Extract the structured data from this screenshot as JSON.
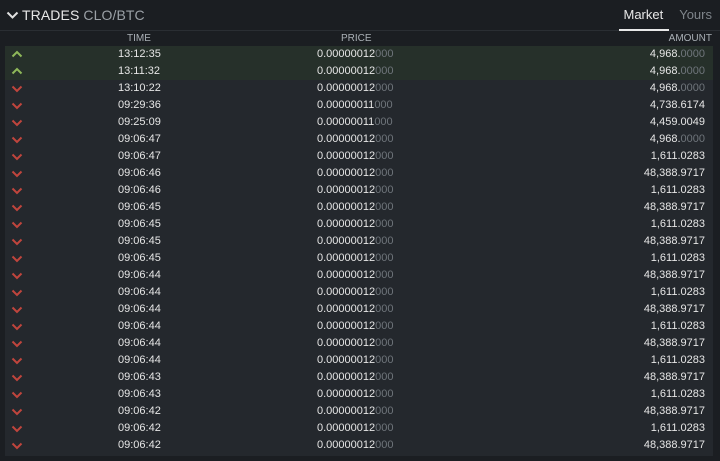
{
  "header": {
    "title": "TRADES",
    "pair": "CLO/BTC",
    "tabs": [
      {
        "label": "Market",
        "active": true
      },
      {
        "label": "Yours",
        "active": false
      }
    ]
  },
  "columns": {
    "time": "TIME",
    "price": "PRICE",
    "amount": "AMOUNT"
  },
  "colors": {
    "up": "#8fb85a",
    "down": "#c0453d",
    "dim": "#6f757b",
    "highlight": "#26302a"
  },
  "trades": [
    {
      "dir": "up",
      "time": "13:12:35",
      "price_main": "0.00000012",
      "price_dim": "000",
      "amount_main": "4,968.",
      "amount_dim": "0000"
    },
    {
      "dir": "up",
      "time": "13:11:32",
      "price_main": "0.00000012",
      "price_dim": "000",
      "amount_main": "4,968.",
      "amount_dim": "0000"
    },
    {
      "dir": "down",
      "time": "13:10:22",
      "price_main": "0.00000012",
      "price_dim": "000",
      "amount_main": "4,968.",
      "amount_dim": "0000"
    },
    {
      "dir": "down",
      "time": "09:29:36",
      "price_main": "0.00000011",
      "price_dim": "000",
      "amount_main": "4,738.6174",
      "amount_dim": ""
    },
    {
      "dir": "down",
      "time": "09:25:09",
      "price_main": "0.00000011",
      "price_dim": "000",
      "amount_main": "4,459.0049",
      "amount_dim": ""
    },
    {
      "dir": "down",
      "time": "09:06:47",
      "price_main": "0.00000012",
      "price_dim": "000",
      "amount_main": "4,968.",
      "amount_dim": "0000"
    },
    {
      "dir": "down",
      "time": "09:06:47",
      "price_main": "0.00000012",
      "price_dim": "000",
      "amount_main": "1,611.0283",
      "amount_dim": ""
    },
    {
      "dir": "down",
      "time": "09:06:46",
      "price_main": "0.00000012",
      "price_dim": "000",
      "amount_main": "48,388.9717",
      "amount_dim": ""
    },
    {
      "dir": "down",
      "time": "09:06:46",
      "price_main": "0.00000012",
      "price_dim": "000",
      "amount_main": "1,611.0283",
      "amount_dim": ""
    },
    {
      "dir": "down",
      "time": "09:06:45",
      "price_main": "0.00000012",
      "price_dim": "000",
      "amount_main": "48,388.9717",
      "amount_dim": ""
    },
    {
      "dir": "down",
      "time": "09:06:45",
      "price_main": "0.00000012",
      "price_dim": "000",
      "amount_main": "1,611.0283",
      "amount_dim": ""
    },
    {
      "dir": "down",
      "time": "09:06:45",
      "price_main": "0.00000012",
      "price_dim": "000",
      "amount_main": "48,388.9717",
      "amount_dim": ""
    },
    {
      "dir": "down",
      "time": "09:06:45",
      "price_main": "0.00000012",
      "price_dim": "000",
      "amount_main": "1,611.0283",
      "amount_dim": ""
    },
    {
      "dir": "down",
      "time": "09:06:44",
      "price_main": "0.00000012",
      "price_dim": "000",
      "amount_main": "48,388.9717",
      "amount_dim": ""
    },
    {
      "dir": "down",
      "time": "09:06:44",
      "price_main": "0.00000012",
      "price_dim": "000",
      "amount_main": "1,611.0283",
      "amount_dim": ""
    },
    {
      "dir": "down",
      "time": "09:06:44",
      "price_main": "0.00000012",
      "price_dim": "000",
      "amount_main": "48,388.9717",
      "amount_dim": ""
    },
    {
      "dir": "down",
      "time": "09:06:44",
      "price_main": "0.00000012",
      "price_dim": "000",
      "amount_main": "1,611.0283",
      "amount_dim": ""
    },
    {
      "dir": "down",
      "time": "09:06:44",
      "price_main": "0.00000012",
      "price_dim": "000",
      "amount_main": "48,388.9717",
      "amount_dim": ""
    },
    {
      "dir": "down",
      "time": "09:06:44",
      "price_main": "0.00000012",
      "price_dim": "000",
      "amount_main": "1,611.0283",
      "amount_dim": ""
    },
    {
      "dir": "down",
      "time": "09:06:43",
      "price_main": "0.00000012",
      "price_dim": "000",
      "amount_main": "48,388.9717",
      "amount_dim": ""
    },
    {
      "dir": "down",
      "time": "09:06:43",
      "price_main": "0.00000012",
      "price_dim": "000",
      "amount_main": "1,611.0283",
      "amount_dim": ""
    },
    {
      "dir": "down",
      "time": "09:06:42",
      "price_main": "0.00000012",
      "price_dim": "000",
      "amount_main": "48,388.9717",
      "amount_dim": ""
    },
    {
      "dir": "down",
      "time": "09:06:42",
      "price_main": "0.00000012",
      "price_dim": "000",
      "amount_main": "1,611.0283",
      "amount_dim": ""
    },
    {
      "dir": "down",
      "time": "09:06:42",
      "price_main": "0.00000012",
      "price_dim": "000",
      "amount_main": "48,388.9717",
      "amount_dim": ""
    }
  ]
}
